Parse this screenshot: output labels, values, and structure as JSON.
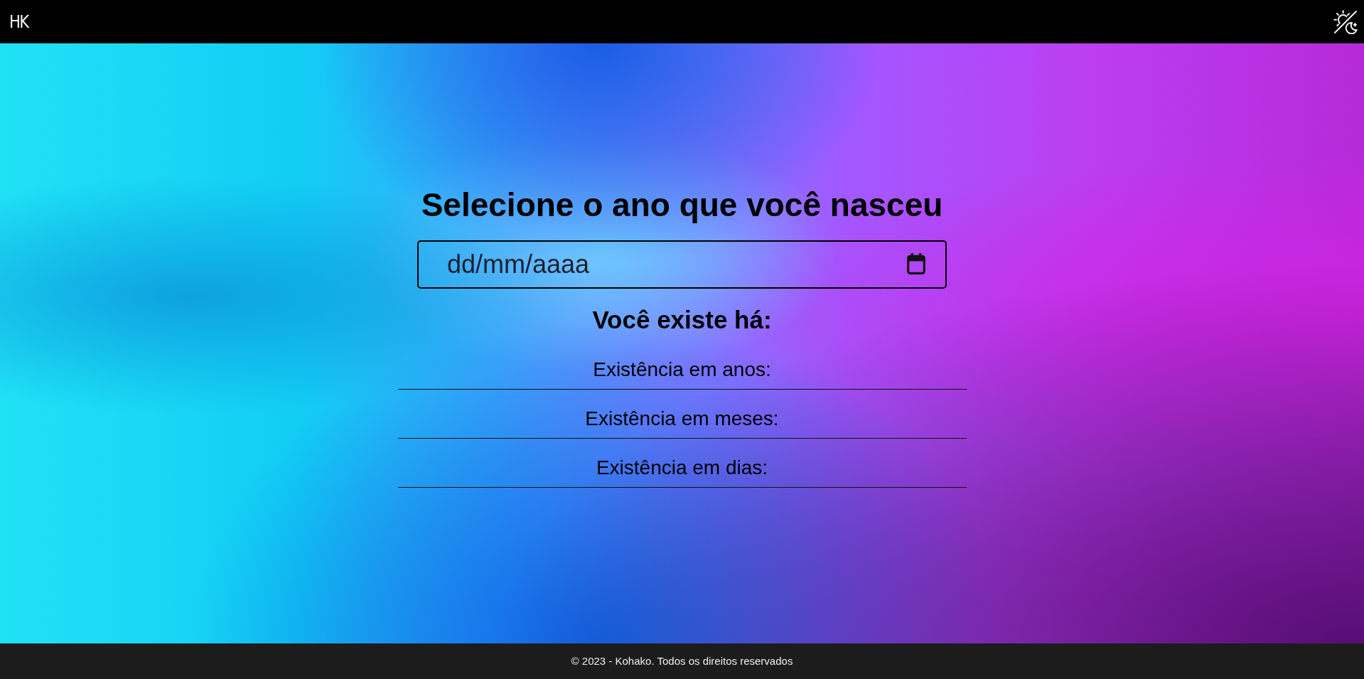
{
  "header": {
    "logo": "HK"
  },
  "form": {
    "title": "Selecione o ano que você nasceu",
    "date_field": {
      "placeholder": "dd/mm/aaaa"
    },
    "result_title": "Você existe há:",
    "results": [
      {
        "label": "Existência em anos:"
      },
      {
        "label": "Existência em meses:"
      },
      {
        "label": "Existência em dias:"
      }
    ]
  },
  "footer": {
    "text": "© 2023 - Kohako. Todos os direitos reservados"
  }
}
